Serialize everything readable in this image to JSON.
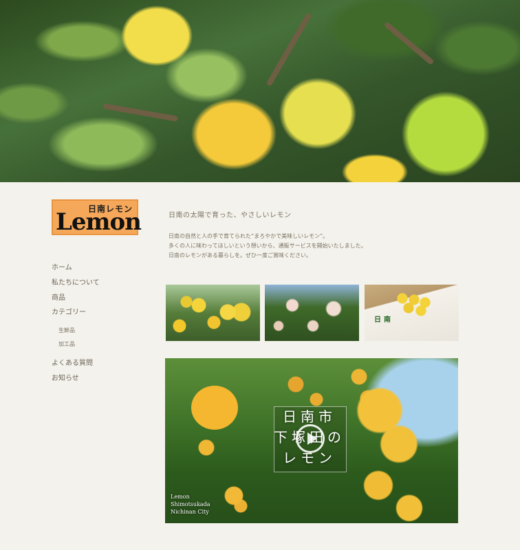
{
  "logo": {
    "jp_text": "日南レモン",
    "brand_text": "Lemon"
  },
  "nav": {
    "items": [
      "ホーム",
      "私たちについて",
      "商品",
      "カテゴリー"
    ],
    "category_sub": [
      "生鮮品",
      "加工品"
    ],
    "items_after": [
      "よくある質問",
      "お知らせ"
    ]
  },
  "main": {
    "headline": "日南の太陽で育った、やさしいレモン",
    "intro_lines": [
      "日南の自然と人の手で育てられた“まろやかで美味しいレモン”。",
      "多くの人に味わってほしいという想いから、通販サービスを開始いたしました。",
      "日南のレモンがある暮らしを。ぜひ一度ご賞味ください。"
    ],
    "box_label": "日南"
  },
  "video": {
    "title_lines": [
      "日南市",
      "下塚田の",
      "レモン"
    ],
    "caption_lines": [
      "Lemon",
      "Shimotsukada",
      "Nichinan City"
    ]
  },
  "colors": {
    "background": "#f4f2ec",
    "logo_bg": "#f5a85a",
    "text": "#6b6456"
  }
}
